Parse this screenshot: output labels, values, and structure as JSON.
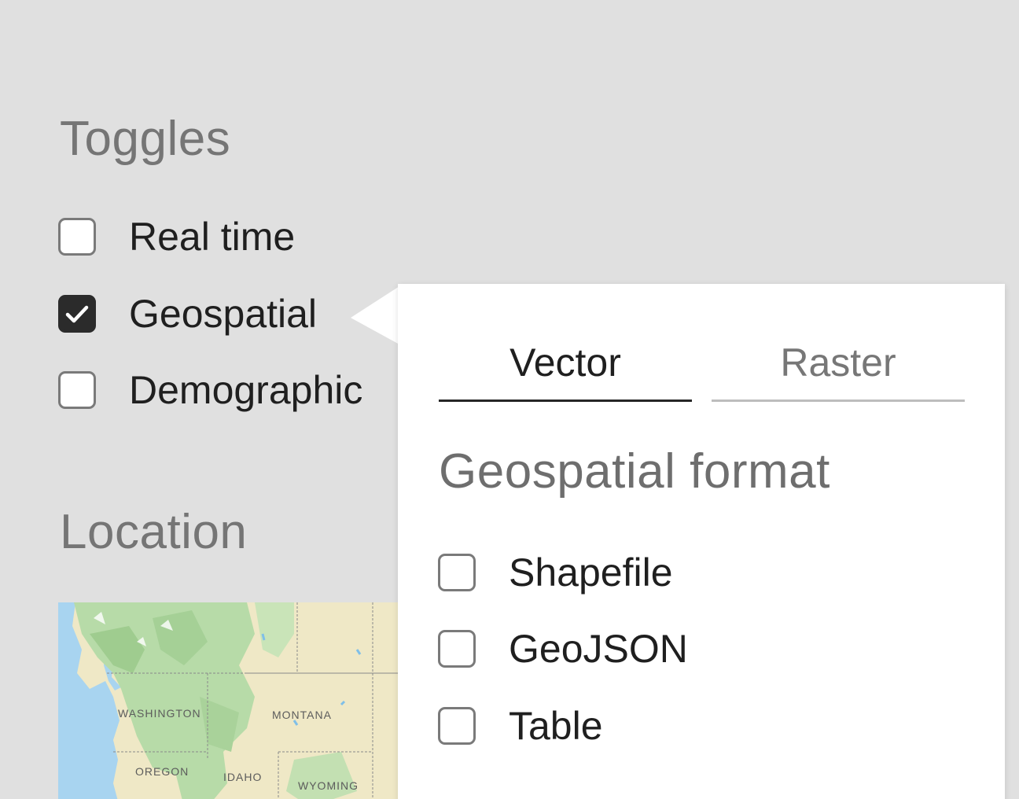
{
  "toggles": {
    "title": "Toggles",
    "items": [
      {
        "label": "Real time",
        "checked": false
      },
      {
        "label": "Geospatial",
        "checked": true
      },
      {
        "label": "Demographic",
        "checked": false
      }
    ]
  },
  "location": {
    "title": "Location",
    "map_labels": {
      "washington": "WASHINGTON",
      "montana": "MONTANA",
      "oregon": "OREGON",
      "idaho": "IDAHO",
      "wyoming": "WYOMING"
    }
  },
  "popover": {
    "tabs": [
      {
        "label": "Vector",
        "active": true
      },
      {
        "label": "Raster",
        "active": false
      }
    ],
    "format_title": "Geospatial format",
    "formats": [
      {
        "label": "Shapefile",
        "checked": false
      },
      {
        "label": "GeoJSON",
        "checked": false
      },
      {
        "label": "Table",
        "checked": false
      }
    ]
  },
  "colors": {
    "background": "#e0e0e0",
    "checkbox_checked": "#2b2b2b",
    "water": "#a8d4f0",
    "land_green": "#b7dba8",
    "land_tan": "#efe8c6"
  },
  "icons": {
    "check": "check-icon",
    "arrow": "popover-arrow"
  }
}
